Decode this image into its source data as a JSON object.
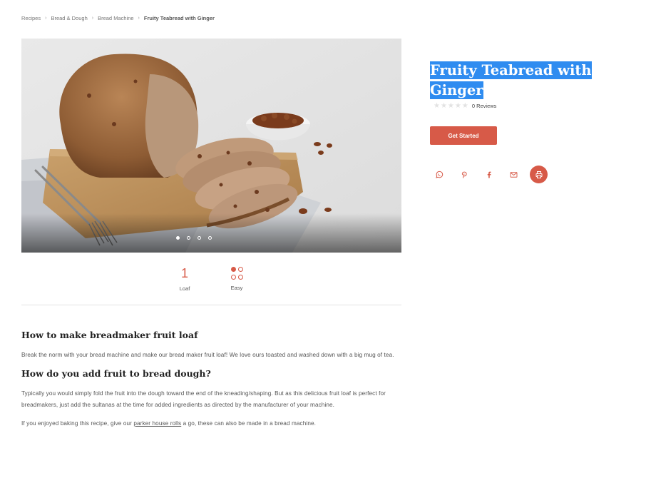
{
  "breadcrumb": {
    "items": [
      "Recipes",
      "Bread & Dough",
      "Bread Machine"
    ],
    "current": "Fruity Teabread with Ginger"
  },
  "recipe": {
    "title": "Fruity Teabread with Ginger",
    "reviews": "0 Reviews",
    "cta_label": "Get Started"
  },
  "gallery": {
    "slide_count": 4,
    "active_index": 0
  },
  "stats": {
    "yield_value": "1",
    "yield_label": "Loaf",
    "difficulty_label": "Easy"
  },
  "share": {
    "icons": [
      "whatsapp-icon",
      "pinterest-icon",
      "facebook-icon",
      "email-icon",
      "print-icon"
    ]
  },
  "article": {
    "h1": "How to make breadmaker fruit loaf",
    "p1": "Break the norm with your bread machine and make our bread maker fruit loaf! We love ours toasted and washed down with a big mug of tea.",
    "h2": "How do you add fruit to bread dough?",
    "p2": "Typically you would simply fold the fruit into the dough toward the end of the kneading/shaping. But as this delicious fruit loaf is perfect for breadmakers, just add the sultanas at the time for added ingredients as directed by the manufacturer of your machine.",
    "p3_before": "If you enjoyed baking this recipe, give our ",
    "p3_link": "parker house rolls",
    "p3_after": " a go, these can also be made in a bread machine."
  },
  "colors": {
    "accent": "#d75a48",
    "selection": "#2f8cf0"
  }
}
